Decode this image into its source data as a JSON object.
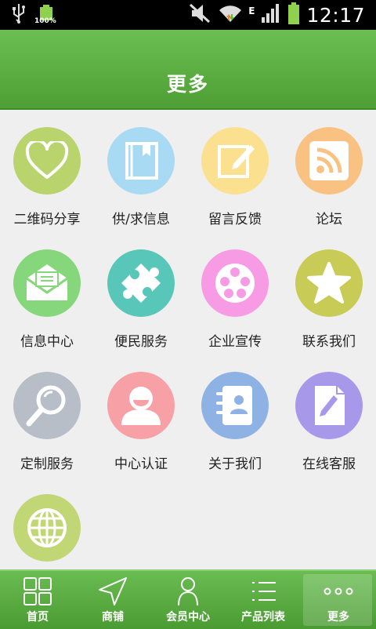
{
  "status_bar": {
    "battery_percent": "100%",
    "network_type": "E",
    "time": "12:17"
  },
  "header": {
    "title": "更多"
  },
  "grid": [
    {
      "label": "二维码分享",
      "icon": "heart-icon",
      "color": "#b9d36d"
    },
    {
      "label": "供/求信息",
      "icon": "book-icon",
      "color": "#a9daf3"
    },
    {
      "label": "留言反馈",
      "icon": "edit-icon",
      "color": "#fbe08f"
    },
    {
      "label": "论坛",
      "icon": "rss-icon",
      "color": "#f9c283"
    },
    {
      "label": "信息中心",
      "icon": "envelope-icon",
      "color": "#86d77b"
    },
    {
      "label": "便民服务",
      "icon": "puzzle-icon",
      "color": "#58c7b9"
    },
    {
      "label": "企业宣传",
      "icon": "film-reel-icon",
      "color": "#f69be4"
    },
    {
      "label": "联系我们",
      "icon": "star-icon",
      "color": "#c8cc57"
    },
    {
      "label": "定制服务",
      "icon": "magnifier-icon",
      "color": "#b7bec8"
    },
    {
      "label": "中心认证",
      "icon": "user-icon",
      "color": "#f7a0a6"
    },
    {
      "label": "关于我们",
      "icon": "contacts-icon",
      "color": "#8db2e3"
    },
    {
      "label": "在线客服",
      "icon": "document-edit-icon",
      "color": "#a898ea"
    },
    {
      "label": "",
      "icon": "globe-icon",
      "color": "#c1d674"
    }
  ],
  "tabs": [
    {
      "label": "首页",
      "icon": "home-grid-icon",
      "active": false
    },
    {
      "label": "商铺",
      "icon": "navigation-arrow-icon",
      "active": false
    },
    {
      "label": "会员中心",
      "icon": "person-icon",
      "active": false
    },
    {
      "label": "产品列表",
      "icon": "list-icon",
      "active": false
    },
    {
      "label": "更多",
      "icon": "more-dots-icon",
      "active": true
    }
  ]
}
